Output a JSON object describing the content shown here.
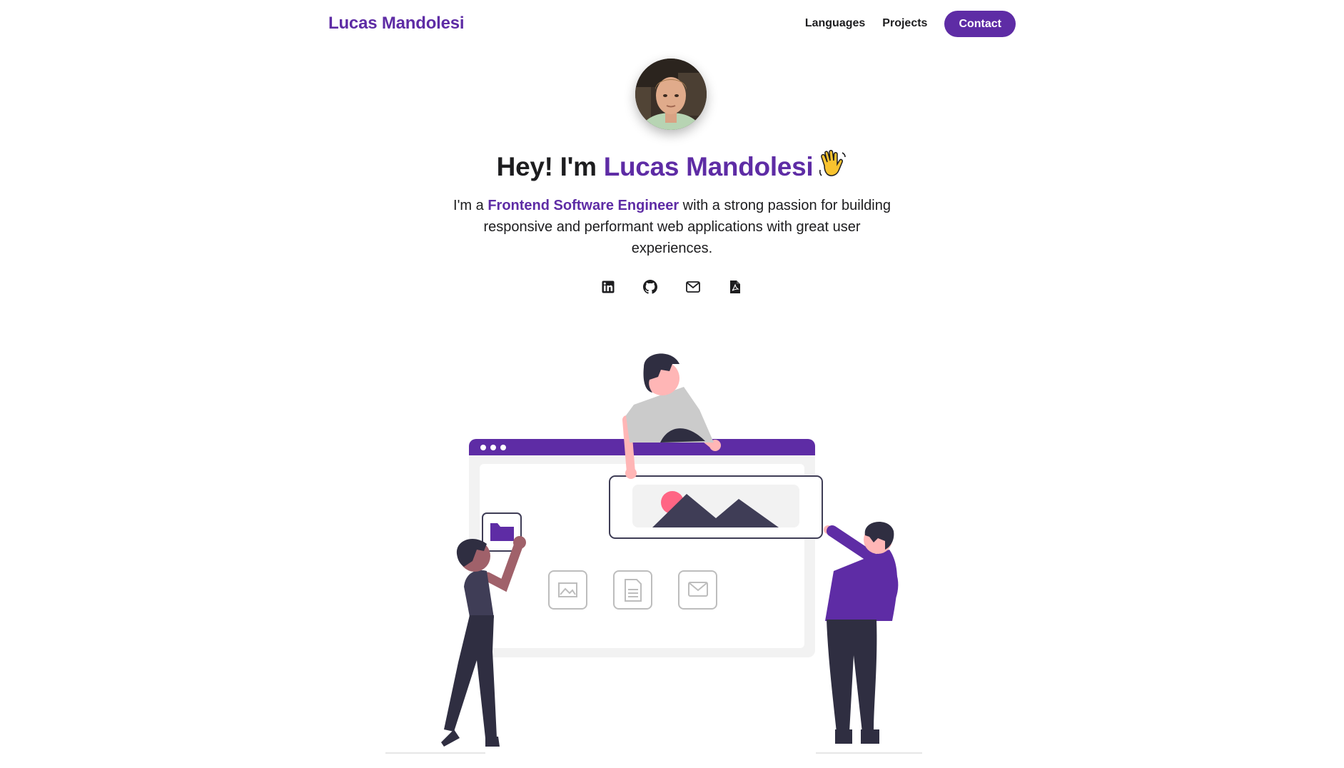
{
  "header": {
    "brand": "Lucas Mandolesi",
    "nav": {
      "languages": "Languages",
      "projects": "Projects",
      "contact": "Contact"
    }
  },
  "hero": {
    "title_prefix": "Hey! I'm ",
    "title_name": "Lucas Mandolesi",
    "desc_prefix": "I'm a ",
    "desc_role": "Frontend Software Engineer",
    "desc_suffix": " with a strong passion for building responsive and performant web applications with great user experiences."
  },
  "socials": [
    {
      "icon": "linkedin-icon"
    },
    {
      "icon": "github-icon"
    },
    {
      "icon": "mail-icon"
    },
    {
      "icon": "pdf-icon"
    }
  ],
  "colors": {
    "accent": "#5e2ca5",
    "text": "#1d1d1f",
    "background": "#ffffff"
  }
}
